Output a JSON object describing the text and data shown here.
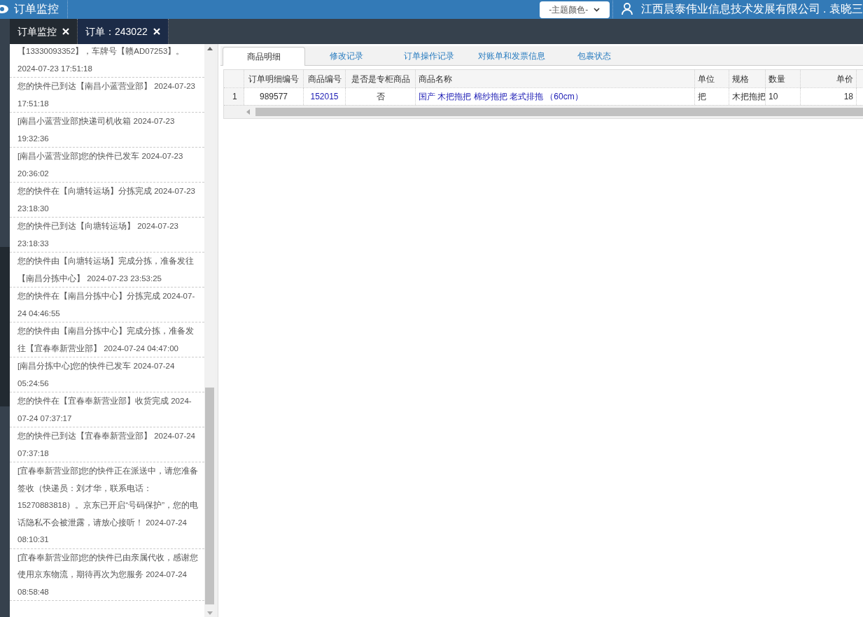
{
  "header": {
    "title": "订单监控",
    "theme_select": "-主题颜色-",
    "user": "江西晨泰伟业信息技术发展有限公司 . 袁晓三"
  },
  "tabs": [
    {
      "label": "订单监控",
      "selected": false
    },
    {
      "label": "订单：243022",
      "selected": true
    }
  ],
  "tracking_log": [
    {
      "text": "【13330093352】，车牌号【赣AD07253】。 2024-07-23 17:51:18"
    },
    {
      "text": "您的快件已到达【南昌小蓝营业部】 2024-07-23 17:51:18"
    },
    {
      "text": "[南昌小蓝营业部]快递司机收箱 2024-07-23 19:32:36"
    },
    {
      "text": "[南昌小蓝营业部]您的快件已发车 2024-07-23 20:36:02"
    },
    {
      "text": "您的快件在【向塘转运场】分拣完成 2024-07-23 23:18:30"
    },
    {
      "text": "您的快件已到达【向塘转运场】 2024-07-23 23:18:33"
    },
    {
      "text": "您的快件由【向塘转运场】完成分拣，准备发往【南昌分拣中心】 2024-07-23 23:53:25"
    },
    {
      "text": "您的快件在【南昌分拣中心】分拣完成 2024-07-24 04:46:55"
    },
    {
      "text": "您的快件由【南昌分拣中心】完成分拣，准备发往【宜春奉新营业部】 2024-07-24 04:47:00"
    },
    {
      "text": "[南昌分拣中心]您的快件已发车 2024-07-24 05:24:56"
    },
    {
      "text": "您的快件在【宜春奉新营业部】收货完成 2024-07-24 07:37:17"
    },
    {
      "text": "您的快件已到达【宜春奉新营业部】 2024-07-24 07:37:18"
    },
    {
      "text": "[宜春奉新营业部]您的快件正在派送中，请您准备签收（快递员：刘才华，联系电话：15270883818）。京东已开启“号码保护”，您的电话隐私不会被泄露，请放心接听！ 2024-07-24 08:10:31"
    },
    {
      "text": "[宜春奉新营业部]您的快件已由亲属代收，感谢您使用京东物流，期待再次为您服务 2024-07-24 08:58:48"
    }
  ],
  "detail_tabs": [
    {
      "label": "商品明细",
      "selected": true
    },
    {
      "label": "修改记录",
      "selected": false
    },
    {
      "label": "订单操作记录",
      "selected": false
    },
    {
      "label": "对账单和发票信息",
      "selected": false
    },
    {
      "label": "包裹状态",
      "selected": false
    }
  ],
  "table": {
    "columns": [
      "订单明细编号",
      "商品编号",
      "是否是专柜商品",
      "商品名称",
      "单位",
      "规格",
      "数量",
      "单价"
    ],
    "rows": [
      {
        "row_number": "1",
        "cells": [
          "989577",
          "152015",
          "否",
          "国产 木把拖把 棉纱拖把 老式排拖 （60cm）",
          "把",
          "木把拖把",
          "10",
          "18"
        ]
      }
    ]
  }
}
